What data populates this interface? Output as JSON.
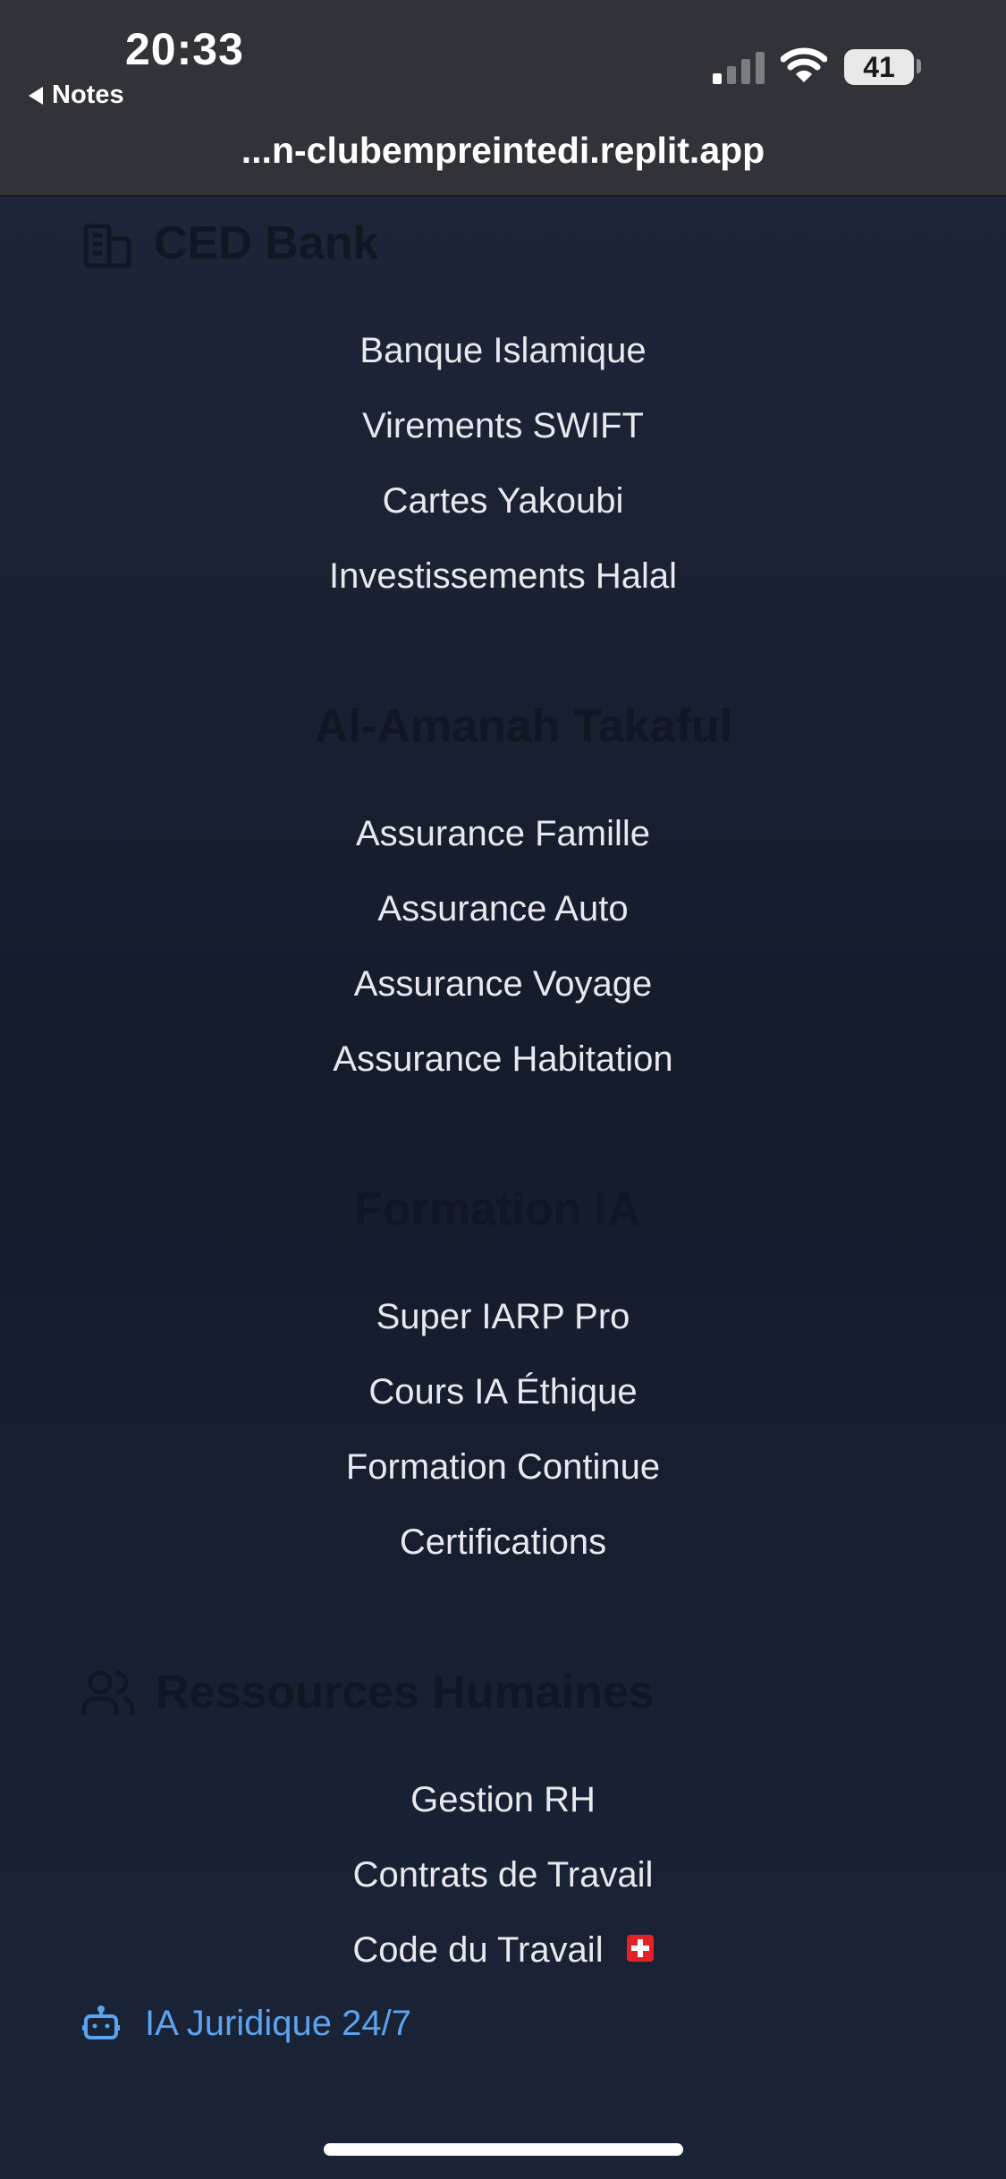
{
  "status_bar": {
    "time": "20:33",
    "back_label": "Notes",
    "battery": "41"
  },
  "browser": {
    "url": "...n-clubempreintedi.replit.app"
  },
  "sections": {
    "bank": {
      "header": "CED Bank",
      "items": [
        "Banque Islamique",
        "Virements SWIFT",
        "Cartes Yakoubi",
        "Investissements Halal"
      ]
    },
    "takaful": {
      "header": "Al-Amanah Takaful",
      "items": [
        "Assurance Famille",
        "Assurance Auto",
        "Assurance Voyage",
        "Assurance Habitation"
      ]
    },
    "formation": {
      "header": "Formation IA",
      "items": [
        "Super IARP Pro",
        "Cours IA Éthique",
        "Formation Continue",
        "Certifications"
      ]
    },
    "rh": {
      "header": "Ressources Humaines",
      "items": [
        "Gestion RH",
        "Contrats de Travail",
        "Code du Travail"
      ]
    }
  },
  "ia_link": {
    "label": "IA Juridique 24/7",
    "icon": "robot-icon"
  },
  "colors": {
    "accent": "#5ba3ef",
    "menu_text": "#e7e9ee",
    "background": "#1a2233"
  }
}
